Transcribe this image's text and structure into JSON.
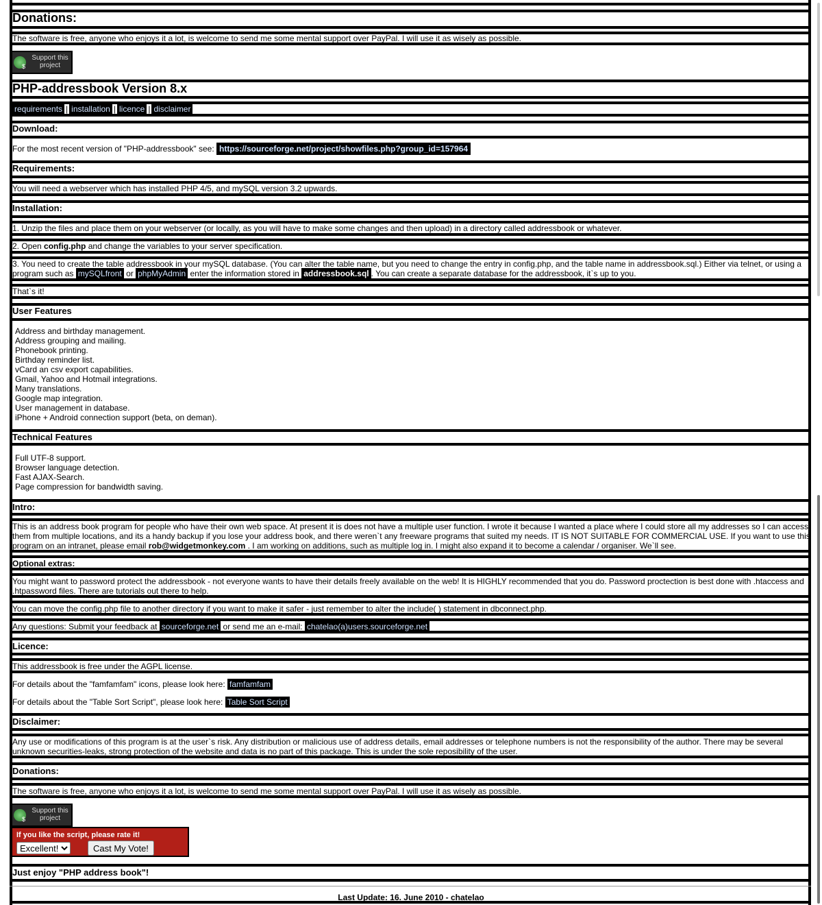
{
  "donations_top": {
    "title": "Donations:",
    "text": "The software is free, anyone who enjoys it a lot, is welcome to send me some mental support over PayPal. I will use it as wisely as possible.",
    "badge_label": "Support this project"
  },
  "version_title": "PHP-addressbook Version 8.x",
  "nav": {
    "links": [
      "requirements",
      "installation",
      "licence",
      "disclaimer"
    ],
    "separator": "|"
  },
  "download": {
    "title": "Download:",
    "text": "For the most recent version of \"PHP-addressbook\" see:",
    "link": "https://sourceforge.net/project/showfiles.php?group_id=157964"
  },
  "requirements": {
    "title": "Requirements:",
    "text": "You will need a webserver which has installed PHP 4/5, and mySQL version 3.2 upwards."
  },
  "installation": {
    "title": "Installation:",
    "step1": "1. Unzip the files and place them on your webserver (or locally, as you will have to make some changes and then upload) in a directory called addressbook or whatever.",
    "step2_pre": "2. Open",
    "step2_bold": "config.php",
    "step2_post": "and change the variables to your server specification.",
    "step3_line1": "3. You need to create the table addressbook in your mySQL database. (You can alter the table name, but you need to change the entry in config.php, and the table name in addressbook.sql.) Either via telnet, or using a",
    "step3_pre": "program such as",
    "step3_link1": "mySQLfront",
    "step3_or": "or",
    "step3_link2": "phpMyAdmin",
    "step3_mid": "enter the information stored in",
    "step3_bold": "addressbook.sql",
    "step3_post": ". You can create a separate database for the addressbook, it`s up to you.",
    "thats_it": "That`s it!"
  },
  "user_features": {
    "title": "User Features",
    "items": [
      "Address and birthday management.",
      "Address grouping and mailing.",
      "Phonebook printing.",
      "Birthday reminder list.",
      "vCard an csv export capabilities.",
      "Gmail, Yahoo and Hotmail integrations.",
      "Many translations.",
      "Google map integration.",
      "User management in database.",
      "iPhone + Android connection support (beta, on deman)."
    ]
  },
  "technical_features": {
    "title": "Technical Features",
    "items": [
      "Full UTF-8 support.",
      "Browser language detection.",
      "Fast AJAX-Search.",
      "Page compression for bandwidth saving."
    ]
  },
  "intro": {
    "title": "Intro:",
    "line1": "This is an address book program for people who have their own web space. At present it is does not have a multiple user function. I wrote it because I wanted a place where I could store all my addresses so I can access",
    "line2": "them from multiple locations, and its a handy backup if you lose your address book, and there weren`t any freeware programs that suited my needs. IT IS NOT SUITABLE FOR COMMERCIAL USE. If you want to use this",
    "line3_pre": "program on an intranet, please email",
    "line3_bold": "rob@widgetmonkey.com",
    "line3_post": ". I am working on additions, such as multiple log in. I might also expand it to become a calendar / organiser. We`ll see."
  },
  "optional": {
    "title": "Optional extras:",
    "p1_line1": "You might want to password protect the addressbook - not everyone wants to have their details freely available on the web! It is HIGHLY recommended that you do. Password proctection is best done with .htaccess and",
    "p1_line2": ".htpassword files. There are tutorials out there to help.",
    "p2": "You can move the config.php file to another directory if you want to make it safer - just remember to alter the include( ) statement in dbconnect.php.",
    "p3_pre": "Any questions: Submit your feedback at",
    "p3_link1": "sourceforge.net",
    "p3_mid": "or send me an e-mail:",
    "p3_link2": "chatelao(a)users.sourceforge.net"
  },
  "licence": {
    "title": "Licence:",
    "text": "This addressbook is free under the AGPL license.",
    "fam_pre": "For details about the \"famfamfam\" icons, please look here:",
    "fam_link": "famfamfam",
    "sort_pre": "For details about the \"Table Sort Script\", please look here:",
    "sort_link": "Table Sort Script"
  },
  "disclaimer": {
    "title": "Disclaimer:",
    "line1": "Any use or modifications of this program is at the user`s risk. Any distribution or malicious use of address details, email addresses or telephone numbers is not the responsibility of the author. There may be several",
    "line2": "unknown securities-leaks, strong protection of the website and data is no part of this package. This is under the sole reposibility of the user."
  },
  "donations_bottom": {
    "title": "Donations:",
    "text": "The software is free, anyone who enjoys it a lot, is welcome to send me some mental support over PayPal. I will use it as wisely as possible.",
    "badge_label": "Support this project"
  },
  "vote": {
    "title": "If you like the script, please rate it!",
    "selected": "Excellent!",
    "button": "Cast My Vote!"
  },
  "enjoy": "Just enjoy \"PHP address book\"!",
  "footer": "Last Update: 16. June 2010 - chatelao"
}
